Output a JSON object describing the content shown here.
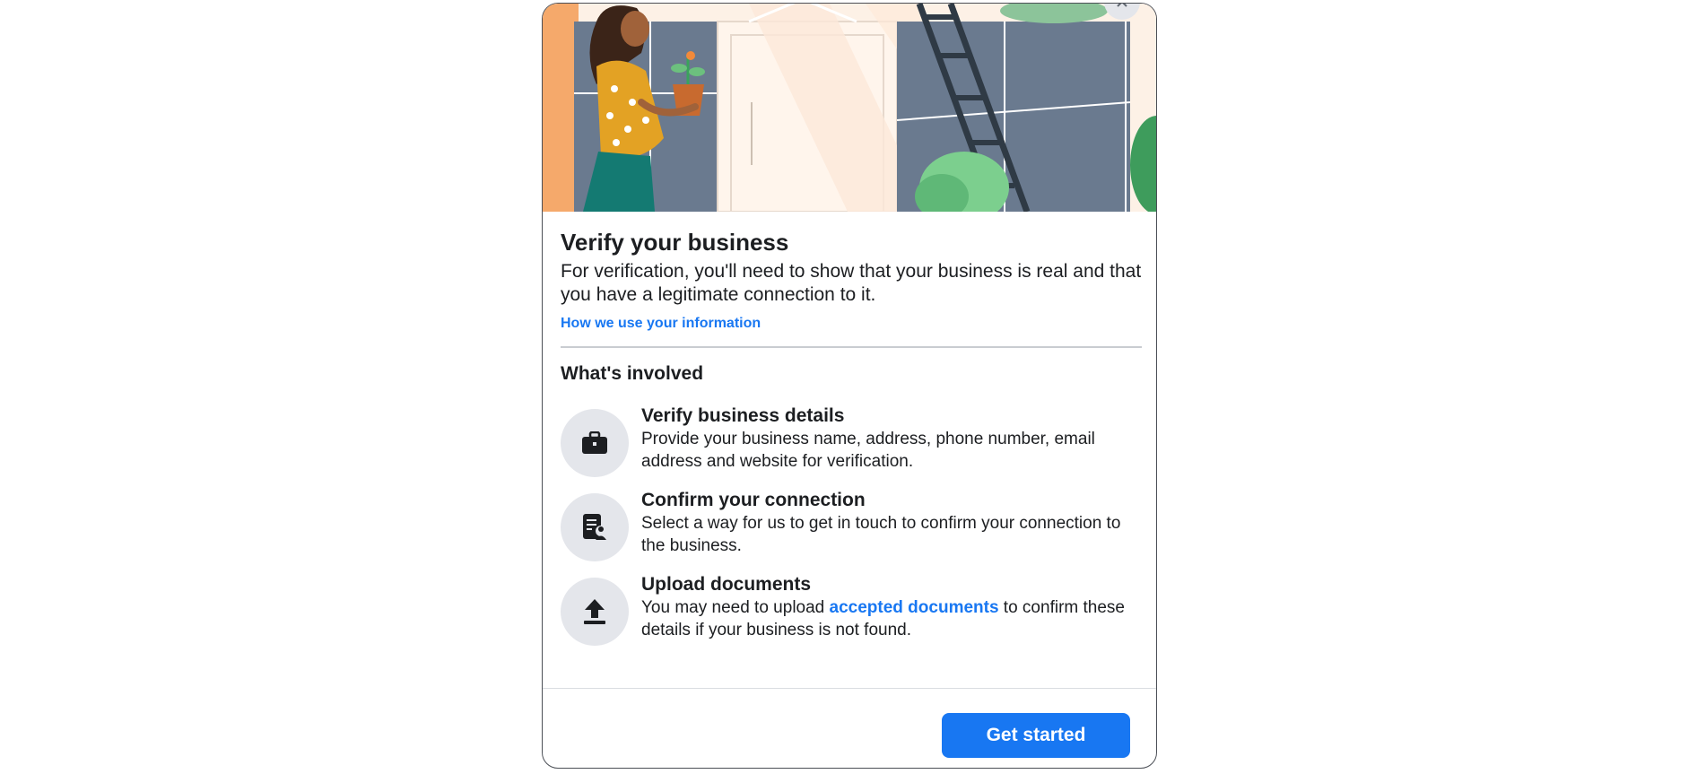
{
  "dialog": {
    "title": "Verify your business",
    "description": "For verification, you'll need to show that your business is real and that you have a legitimate connection to it.",
    "info_link": "How we use your information",
    "section_title": "What's involved",
    "steps": [
      {
        "icon": "briefcase-icon",
        "title": "Verify business details",
        "description": "Provide your business name, address, phone number, email address and website for verification."
      },
      {
        "icon": "document-person-icon",
        "title": "Confirm your connection",
        "description": "Select a way for us to get in touch to confirm your connection to the business."
      },
      {
        "icon": "upload-icon",
        "title": "Upload documents",
        "description_before": "You may need to upload ",
        "description_link": "accepted documents",
        "description_after": " to confirm these details if your business is not found."
      }
    ],
    "primary_button": "Get started"
  },
  "colors": {
    "accent": "#1877f2",
    "icon_bg": "#e4e6eb",
    "text": "#1c1e21"
  }
}
